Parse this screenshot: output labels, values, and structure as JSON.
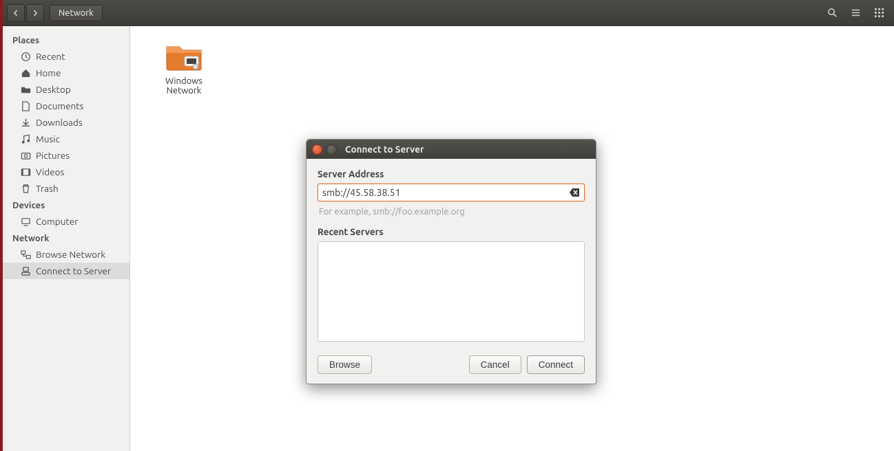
{
  "toolbar": {
    "location": "Network"
  },
  "sidebar": {
    "places_header": "Places",
    "places": [
      {
        "label": "Recent",
        "icon": "clock"
      },
      {
        "label": "Home",
        "icon": "home"
      },
      {
        "label": "Desktop",
        "icon": "folder"
      },
      {
        "label": "Documents",
        "icon": "doc"
      },
      {
        "label": "Downloads",
        "icon": "download"
      },
      {
        "label": "Music",
        "icon": "music"
      },
      {
        "label": "Pictures",
        "icon": "camera"
      },
      {
        "label": "Videos",
        "icon": "video"
      },
      {
        "label": "Trash",
        "icon": "trash"
      }
    ],
    "devices_header": "Devices",
    "devices": [
      {
        "label": "Computer",
        "icon": "computer"
      }
    ],
    "network_header": "Network",
    "network": [
      {
        "label": "Browse Network",
        "icon": "browse"
      },
      {
        "label": "Connect to Server",
        "icon": "connect"
      }
    ]
  },
  "content": {
    "items": [
      {
        "label": "Windows Network"
      }
    ]
  },
  "dialog": {
    "title": "Connect to Server",
    "address_label": "Server Address",
    "address_value": "smb://45.58.38.51",
    "hint": "For example, smb://foo.example.org",
    "recent_label": "Recent Servers",
    "browse": "Browse",
    "cancel": "Cancel",
    "connect": "Connect"
  }
}
